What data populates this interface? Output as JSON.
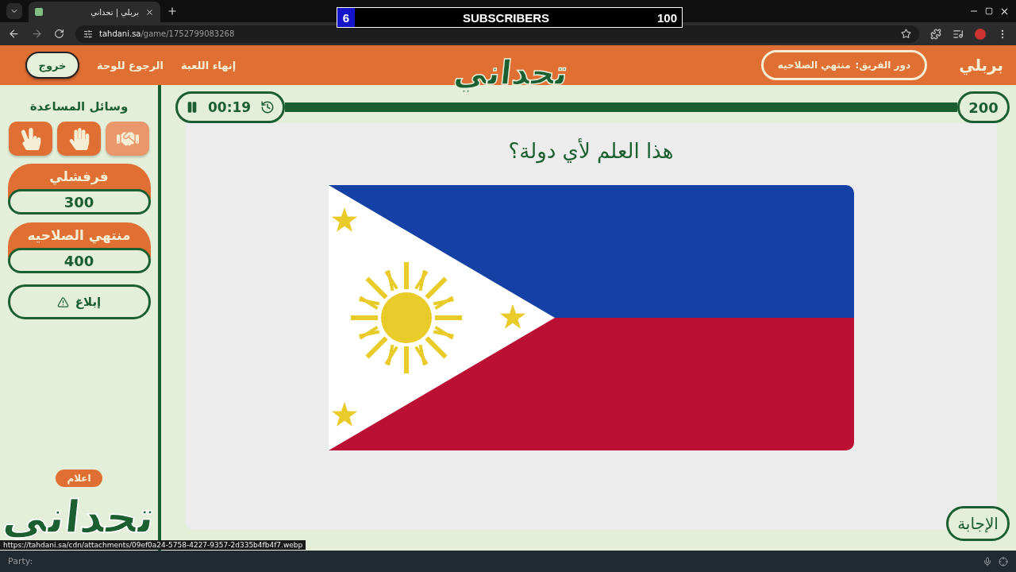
{
  "browser": {
    "tab_title": "بربلي | تحداني",
    "url_host": "tahdani.sa",
    "url_path": "/game/1752799083268"
  },
  "overlay": {
    "count": "6",
    "label": "SUBSCRIBERS",
    "goal": "100"
  },
  "header": {
    "title": "بربلي",
    "turn_label": "دور الفريق:",
    "turn_team": "منتهي الصلاحيه",
    "logo": "تحداني",
    "links": [
      "إنهاء اللعبة",
      "الرجوع للوحة"
    ],
    "exit": "خروج"
  },
  "sidebar": {
    "title": "وسائل المساعدة",
    "aids": [
      {
        "kind": "peace",
        "used": false
      },
      {
        "kind": "hand",
        "used": false
      },
      {
        "kind": "handshake",
        "used": true
      }
    ],
    "teams": [
      {
        "name": "فرفشلي",
        "score": "300"
      },
      {
        "name": "منتهي الصلاحيه",
        "score": "400"
      }
    ],
    "report": "إبلاغ",
    "flags_badge": "اعلام",
    "logo": "تحداني"
  },
  "game": {
    "timer": "00:19",
    "score": "200",
    "question": "هذا العلم لأي دولة؟",
    "answer": "الإجابة"
  },
  "status": {
    "link": "https://tahdani.sa/cdn/attachments/09ef0a24-5758-4227-9357-2d335b4fb4f7.webp",
    "party": "Party:"
  }
}
